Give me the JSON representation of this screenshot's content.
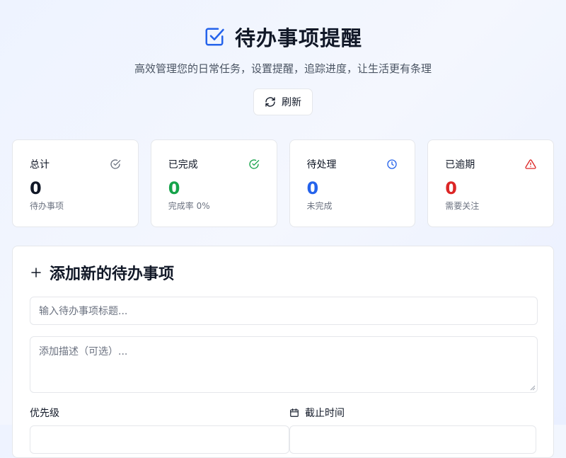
{
  "header": {
    "title": "待办事项提醒",
    "subtitle": "高效管理您的日常任务，设置提醒，追踪进度，让生活更有条理",
    "refresh_label": "刷新"
  },
  "stats": [
    {
      "label": "总计",
      "value": "0",
      "sub": "待办事项",
      "icon": "circle-check-icon",
      "color": "#111827",
      "icon_color": "#6b7280"
    },
    {
      "label": "已完成",
      "value": "0",
      "sub": "完成率 0%",
      "icon": "circle-check-icon",
      "color": "#16a34a",
      "icon_color": "#16a34a"
    },
    {
      "label": "待处理",
      "value": "0",
      "sub": "未完成",
      "icon": "clock-icon",
      "color": "#2563eb",
      "icon_color": "#2563eb"
    },
    {
      "label": "已逾期",
      "value": "0",
      "sub": "需要关注",
      "icon": "warning-icon",
      "color": "#dc2626",
      "icon_color": "#dc2626"
    }
  ],
  "form": {
    "title": "添加新的待办事项",
    "title_placeholder": "输入待办事项标题...",
    "desc_placeholder": "添加描述（可选）...",
    "priority_label": "优先级",
    "deadline_label": "截止时间"
  },
  "colors": {
    "accent": "#2563eb",
    "success": "#16a34a",
    "danger": "#dc2626"
  }
}
